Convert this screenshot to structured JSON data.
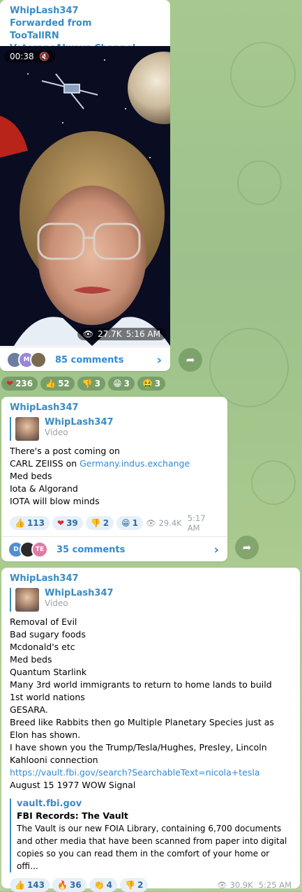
{
  "post1": {
    "author": "WhipLash347",
    "forwarded": "Forwarded from TooTallRN VeteransAlways Channel",
    "duration": "00:38",
    "views": "27.7K",
    "time": "5:16 AM",
    "comments": "85 comments",
    "avatars": [
      "",
      "M",
      ""
    ],
    "reactions": [
      {
        "emoji": "❤",
        "count": "236"
      },
      {
        "emoji": "👍",
        "count": "52"
      },
      {
        "emoji": "👎",
        "count": "3"
      },
      {
        "emoji": "😁",
        "count": "3"
      },
      {
        "emoji": "🤮",
        "count": "3"
      }
    ]
  },
  "post2": {
    "author": "WhipLash347",
    "reply_name": "WhipLash347",
    "reply_sub": "Video",
    "line1": "There's a post coming on",
    "line2_prefix": "CARL ZEIISS on ",
    "line2_link": "Germany.indus.exchange",
    "line3": "Med beds",
    "line4": "Iota & Algorand",
    "line5": "IOTA will blow minds",
    "reactions": [
      {
        "emoji": "👍",
        "count": "113"
      },
      {
        "emoji": "❤",
        "count": "39"
      },
      {
        "emoji": "👎",
        "count": "2"
      },
      {
        "emoji": "😁",
        "count": "1"
      }
    ],
    "views": "29.4K",
    "time": "5:17 AM",
    "comments": "35 comments",
    "avatars": [
      "D",
      "",
      "TE"
    ]
  },
  "post3": {
    "author": "WhipLash347",
    "reply_name": "WhipLash347",
    "reply_sub": "Video",
    "lines": [
      "Removal of Evil",
      "Bad sugary foods",
      "Mcdonald's etc",
      "Med beds",
      "Quantum Starlink",
      "Many 3rd world immigrants to return to home lands to build 1st world nations",
      "GESARA.",
      "Breed like Rabbits then go Multiple Planetary Species just as Elon has shown.",
      "I have shown you the Trump/Tesla/Hughes, Presley, Lincoln Kahlooni connection"
    ],
    "link": "https://vault.fbi.gov/search?SearchableText=nicola+tesla",
    "after_link": "August 15 1977 WOW Signal",
    "preview_site": "vault.fbi.gov",
    "preview_title": "FBI Records: The Vault",
    "preview_desc": "The Vault is our new FOIA Library, containing 6,700 documents and other media that have been scanned from paper into digital copies so you can read them in the comfort of your home or offi…",
    "reactions": [
      {
        "emoji": "👍",
        "count": "143"
      },
      {
        "emoji": "🔥",
        "count": "36"
      },
      {
        "emoji": "👏",
        "count": "4"
      },
      {
        "emoji": "👎",
        "count": "2"
      }
    ],
    "views": "30.9K",
    "time": "5:25 AM"
  },
  "colors": {
    "accent": "#3a8bc2",
    "link": "#2f8ad8",
    "reaction_bg": "#e7f0f9"
  }
}
